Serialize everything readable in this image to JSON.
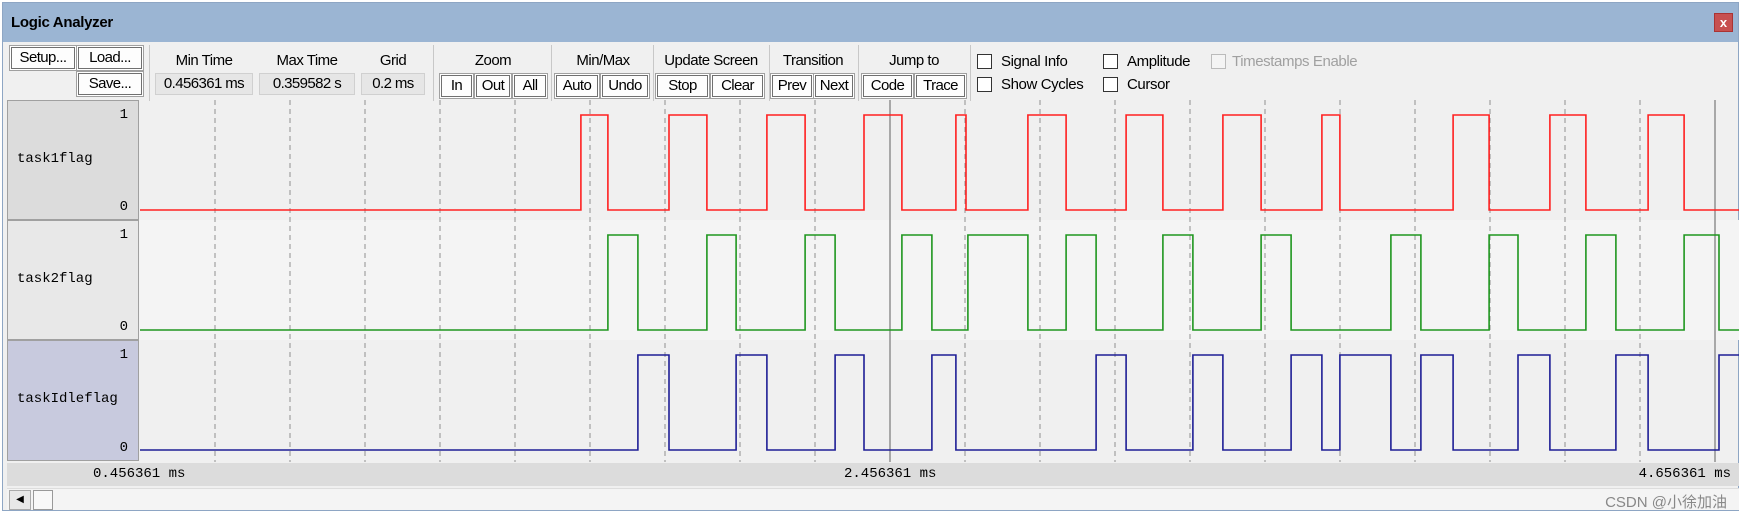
{
  "window": {
    "title": "Logic Analyzer",
    "close_icon": "close-icon"
  },
  "toolbar": {
    "setup": "Setup...",
    "load": "Load...",
    "save": "Save...",
    "min_time_label": "Min Time",
    "min_time_value": "0.456361 ms",
    "max_time_label": "Max Time",
    "max_time_value": "0.359582 s",
    "grid_label": "Grid",
    "grid_value": "0.2 ms",
    "zoom_label": "Zoom",
    "zoom_in": "In",
    "zoom_out": "Out",
    "zoom_all": "All",
    "minmax_label": "Min/Max",
    "auto": "Auto",
    "undo": "Undo",
    "update_label": "Update Screen",
    "stop": "Stop",
    "clear": "Clear",
    "transition_label": "Transition",
    "prev": "Prev",
    "next": "Next",
    "jump_label": "Jump to",
    "code": "Code",
    "trace": "Trace"
  },
  "checkboxes": [
    {
      "label": "Signal Info",
      "checked": false,
      "enabled": true
    },
    {
      "label": "Amplitude",
      "checked": false,
      "enabled": true
    },
    {
      "label": "Timestamps Enable",
      "checked": false,
      "enabled": false
    },
    {
      "label": "Show Cycles",
      "checked": false,
      "enabled": true
    },
    {
      "label": "Cursor",
      "checked": false,
      "enabled": true
    }
  ],
  "axis_labels": [
    "0.456361 ms",
    "2.456361 ms",
    "4.656361 ms"
  ],
  "watermark": "CSDN @小徐加油",
  "chart_data": {
    "type": "line",
    "x_unit": "ms",
    "xlim": [
      0.456361,
      4.723
    ],
    "grid_step": 0.2,
    "grid": true,
    "markers": [
      0.456361,
      2.456361,
      4.656361
    ],
    "signals": [
      {
        "name": "task1flag",
        "high": "1",
        "low": "0",
        "color": "#ff2020",
        "initial": 0,
        "transitions": [
          1.632,
          1.704,
          1.867,
          1.968,
          2.128,
          2.23,
          2.387,
          2.488,
          2.632,
          2.659,
          2.824,
          2.926,
          3.086,
          3.184,
          3.344,
          3.446,
          3.608,
          3.656,
          3.958,
          4.054,
          4.216,
          4.312,
          4.478,
          4.574
        ]
      },
      {
        "name": "task2flag",
        "high": "1",
        "low": "0",
        "color": "#1e961e",
        "initial": 0,
        "transitions": [
          1.704,
          1.784,
          1.968,
          2.046,
          2.23,
          2.31,
          2.488,
          2.568,
          2.664,
          2.824,
          2.926,
          3.006,
          3.184,
          3.264,
          3.446,
          3.526,
          3.792,
          3.872,
          4.054,
          4.131,
          4.312,
          4.392,
          4.574,
          4.667
        ]
      },
      {
        "name": "taskIdleflag",
        "high": "1",
        "low": "0",
        "color": "#1e1e96",
        "initial": 0,
        "transitions": [
          1.784,
          1.867,
          2.046,
          2.128,
          2.31,
          2.387,
          2.568,
          2.632,
          3.006,
          3.086,
          3.264,
          3.344,
          3.526,
          3.608,
          3.656,
          3.792,
          3.872,
          3.958,
          4.131,
          4.216,
          4.392,
          4.478,
          4.667
        ]
      }
    ]
  }
}
